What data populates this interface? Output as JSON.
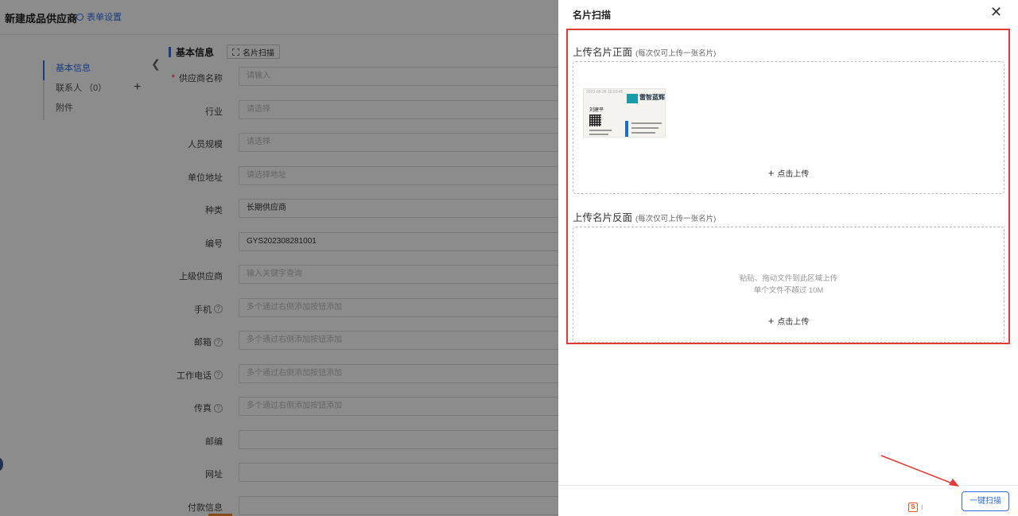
{
  "page": {
    "title": "新建成品供应商",
    "form_settings_label": "表单设置",
    "section_title": "基本信息",
    "scan_button_label": "名片扫描"
  },
  "sidebar": {
    "items": [
      {
        "label": "基本信息",
        "active": true
      },
      {
        "label": "联系人 （0）",
        "active": false
      },
      {
        "label": "附件",
        "active": false
      }
    ],
    "add_symbol": "+"
  },
  "form": {
    "rows": [
      {
        "label": "供应商名称",
        "required": true,
        "value": "",
        "placeholder": "请输入",
        "help": false
      },
      {
        "label": "行业",
        "required": false,
        "value": "",
        "placeholder": "请选择",
        "help": false
      },
      {
        "label": "人员规模",
        "required": false,
        "value": "",
        "placeholder": "请选择",
        "help": false
      },
      {
        "label": "单位地址",
        "required": false,
        "value": "",
        "placeholder": "请选择地址",
        "help": false,
        "select": true
      },
      {
        "label": "种类",
        "required": false,
        "value": "长期供应商",
        "placeholder": "",
        "help": false
      },
      {
        "label": "编号",
        "required": false,
        "value": "GYS202308281001",
        "placeholder": "",
        "help": false
      },
      {
        "label": "上级供应商",
        "required": false,
        "value": "",
        "placeholder": "输入关键字查询",
        "help": false
      },
      {
        "label": "手机",
        "required": false,
        "value": "",
        "placeholder": "多个通过右侧添加按钮添加",
        "help": true
      },
      {
        "label": "邮箱",
        "required": false,
        "value": "",
        "placeholder": "多个通过右侧添加按钮添加",
        "help": true
      },
      {
        "label": "工作电话",
        "required": false,
        "value": "",
        "placeholder": "多个通过右侧添加按钮添加",
        "help": true
      },
      {
        "label": "传真",
        "required": false,
        "value": "",
        "placeholder": "多个通过右侧添加按钮添加",
        "help": true
      },
      {
        "label": "邮编",
        "required": false,
        "value": "",
        "placeholder": "",
        "help": false
      },
      {
        "label": "网址",
        "required": false,
        "value": "",
        "placeholder": "",
        "help": false
      },
      {
        "label": "付款信息",
        "required": false,
        "value": "",
        "placeholder": "",
        "help": false
      }
    ]
  },
  "drawer": {
    "title": "名片扫描",
    "close_symbol": "✕",
    "front": {
      "heading": "上传名片正面",
      "hint": "(每次仅可上传一张名片)",
      "upload_label": "点击上传",
      "card": {
        "timestamp": "2023-08-28  15:03:46",
        "brand": "雷智蓝辉",
        "name": "刘建平"
      }
    },
    "back": {
      "heading": "上传名片反面",
      "hint": "(每次仅可上传一张名片)",
      "drop_hint_1": "粘贴、拖动文件到此区域上传",
      "drop_hint_2": "单个文件不超过 10M",
      "upload_label": "点击上传"
    },
    "footer": {
      "scan_button_label": "一键扫描",
      "widget_badge": "S",
      "widget_dots": "⁝"
    }
  },
  "colors": {
    "accent": "#2f6fe6",
    "annotation": "#e53935"
  }
}
